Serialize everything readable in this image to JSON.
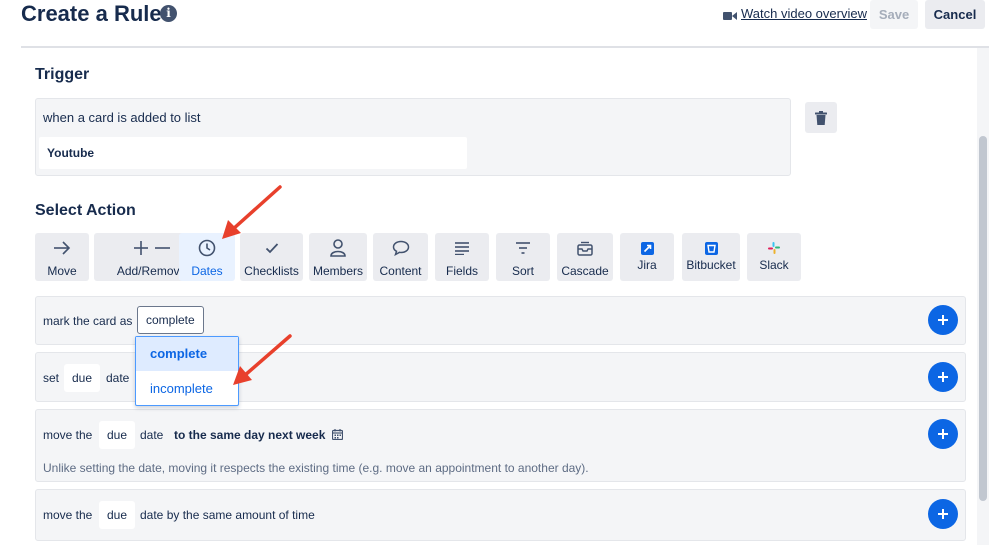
{
  "header": {
    "title": "Create a Rule",
    "info_glyph": "i",
    "video_link": "Watch video overview",
    "save_label": "Save",
    "cancel_label": "Cancel"
  },
  "trigger": {
    "section_title": "Trigger",
    "text": "when a card is added to list",
    "list_name": "Youtube"
  },
  "select_action": {
    "section_title": "Select Action",
    "tabs": [
      {
        "label": "Move",
        "icon": "arrow-right-icon"
      },
      {
        "label": "Add/Remove",
        "icon": "plus-minus-icon"
      },
      {
        "label": "Dates",
        "icon": "clock-icon",
        "active": true
      },
      {
        "label": "Checklists",
        "icon": "check-icon"
      },
      {
        "label": "Members",
        "icon": "person-icon"
      },
      {
        "label": "Content",
        "icon": "speech-bubble-icon"
      },
      {
        "label": "Fields",
        "icon": "lines-icon"
      },
      {
        "label": "Sort",
        "icon": "filter-icon"
      },
      {
        "label": "Cascade",
        "icon": "inbox-icon"
      },
      {
        "label": "Jira",
        "icon": "jira-logo-icon"
      },
      {
        "label": "Bitbucket",
        "icon": "bitbucket-logo-icon"
      },
      {
        "label": "Slack",
        "icon": "slack-logo-icon"
      }
    ]
  },
  "actions": [
    {
      "prefix": "mark the card as",
      "value": "complete"
    },
    {
      "prefix": "set",
      "field": "due",
      "suffix": "date"
    },
    {
      "prefix": "move the",
      "field": "due",
      "middle": "date",
      "target": "to the same day next week",
      "hint": "Unlike setting the date, moving it respects the existing time (e.g. move an appointment to another day)."
    },
    {
      "prefix": "move the",
      "field": "due",
      "suffix": "date by the same amount of time"
    }
  ],
  "dropdown": {
    "options": [
      "complete",
      "incomplete"
    ],
    "selected": "complete"
  },
  "colors": {
    "accent": "#0c66e4",
    "annotation_arrow": "#e8402c"
  }
}
